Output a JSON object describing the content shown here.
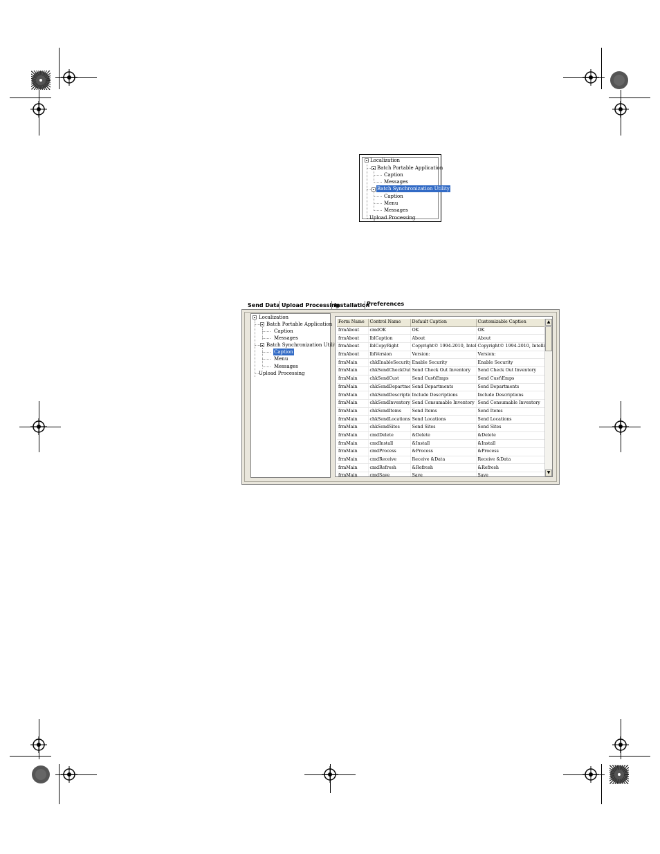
{
  "small_tree": {
    "nodes": [
      "Localization",
      "Batch Portable Application",
      "Caption",
      "Messages",
      "Batch Synchronization Utility",
      "Caption",
      "Menu",
      "Messages",
      "Upload Processing"
    ]
  },
  "dialog": {
    "tabs": [
      "Send Data",
      "Upload Processing",
      "Installation",
      "Preferences"
    ],
    "active_tab": "Preferences",
    "tree": {
      "nodes": [
        "Localization",
        "Batch Portable Application",
        "Caption",
        "Messages",
        "Batch Synchronization Utility",
        "Caption",
        "Menu",
        "Messages",
        "Upload Processing"
      ]
    },
    "grid": {
      "columns": [
        "Form Name",
        "Control Name",
        "Default Caption",
        "Customizable Caption"
      ],
      "rows": [
        [
          "frmAbout",
          "cmdOK",
          "OK",
          "OK"
        ],
        [
          "frmAbout",
          "lblCaption",
          "About",
          "About"
        ],
        [
          "frmAbout",
          "lblCopyRight",
          "Copyright© 1994-2010, Intelli",
          "Copyright© 1994-2010, Intelli"
        ],
        [
          "frmAbout",
          "lblVersion",
          "Version:",
          "Version:"
        ],
        [
          "frmMain",
          "chkEnableSecurity",
          "Enable Security",
          "Enable Security"
        ],
        [
          "frmMain",
          "chkSendCheckOut",
          "Send Check Out Inventory",
          "Send Check Out Inventory"
        ],
        [
          "frmMain",
          "chkSendCust",
          "Send Cust\\Emps",
          "Send Cust\\Emps"
        ],
        [
          "frmMain",
          "chkSendDepartme",
          "Send Departments",
          "Send Departments"
        ],
        [
          "frmMain",
          "chkSendDescriptio",
          "Include Descriptions",
          "Include Descriptions"
        ],
        [
          "frmMain",
          "chkSendInventory",
          "Send Consumable Inventory",
          "Send Consumable Inventory"
        ],
        [
          "frmMain",
          "chkSendItems",
          "Send Items",
          "Send Items"
        ],
        [
          "frmMain",
          "chkSendLocations",
          "Send Locations",
          "Send Locations"
        ],
        [
          "frmMain",
          "chkSendSites",
          "Send Sites",
          "Send Sites"
        ],
        [
          "frmMain",
          "cmdDelete",
          "&Delete",
          "&Delete"
        ],
        [
          "frmMain",
          "cmdInstall",
          "&Install",
          "&Install"
        ],
        [
          "frmMain",
          "cmdProcess",
          "&Process",
          "&Process"
        ],
        [
          "frmMain",
          "cmdReceive",
          "Receive &Data",
          "Receive &Data"
        ],
        [
          "frmMain",
          "cmdRefresh",
          "&Refresh",
          "&Refresh"
        ],
        [
          "frmMain",
          "cmdSave",
          "Save",
          "Save"
        ],
        [
          "frmMain",
          "cmdSendData",
          "&Send",
          "&Send"
        ]
      ]
    }
  },
  "colors": {
    "selection": "#316ac5",
    "panel": "#e9e6dc",
    "header": "#ece9d8"
  },
  "icons": {
    "scroll_up": "scroll-up-arrow-icon",
    "scroll_down": "scroll-down-arrow-icon"
  }
}
